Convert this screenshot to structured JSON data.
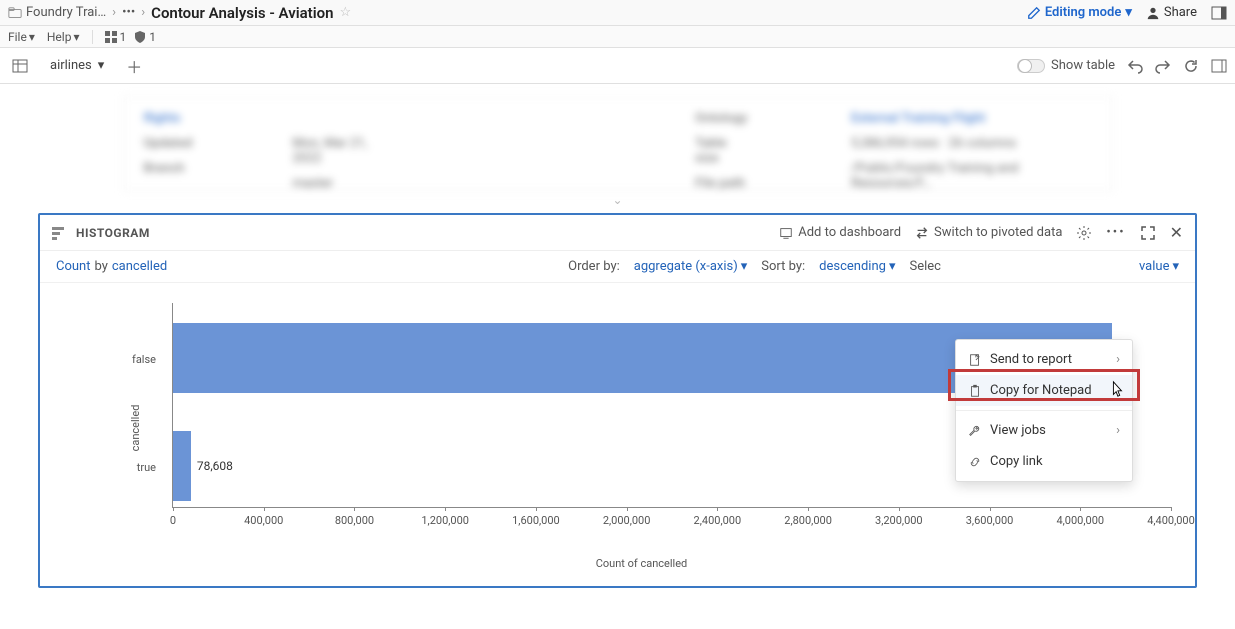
{
  "breadcrumb": {
    "item1": "Foundry Trai…",
    "ellipsis": "•••",
    "title": "Contour Analysis - Aviation"
  },
  "header": {
    "editing_mode": "Editing mode",
    "share": "Share"
  },
  "menubar": {
    "file": "File",
    "help": "Help",
    "badge1_count": "1",
    "badge2_count": "1"
  },
  "toolbar": {
    "dataset_chip": "airlines",
    "show_table": "Show table"
  },
  "blurred": {
    "col1": {
      "a": "flights",
      "b": "Updated",
      "c": "Branch"
    },
    "col2": {
      "a": "",
      "b": "Mon, Mar 21, 2022",
      "c": "master"
    },
    "col3": {
      "a": "Ontology",
      "b": "Table size",
      "c": "File path"
    },
    "col4": {
      "a": "External Training Flight",
      "b": "5,386,954 rows · 26 columns",
      "c": "/Public/Foundry Training and Resources/F…"
    }
  },
  "panel": {
    "title": "HISTOGRAM",
    "add_dashboard": "Add to dashboard",
    "switch_pivoted": "Switch to pivoted data",
    "count": "Count",
    "by": "by",
    "cancelled": "cancelled",
    "order_by_lbl": "Order by:",
    "order_by_val": "aggregate (x-axis)",
    "sort_by_lbl": "Sort by:",
    "sort_by_val": "descending",
    "select_lbl": "Select",
    "select_partial": "Selec",
    "value": "value"
  },
  "chart_data": {
    "type": "bar",
    "orientation": "horizontal",
    "categories": [
      "false",
      "true"
    ],
    "values": [
      4140000,
      78608
    ],
    "value_labels": [
      "",
      "78,608"
    ],
    "xlabel": "Count of cancelled",
    "ylabel": "cancelled",
    "xlim": [
      0,
      4400000
    ],
    "ticks": [
      0,
      400000,
      800000,
      1200000,
      1600000,
      2000000,
      2400000,
      2800000,
      3200000,
      3600000,
      4000000,
      4400000
    ],
    "tick_labels": [
      "0",
      "400,000",
      "800,000",
      "1,200,000",
      "1,600,000",
      "2,000,000",
      "2,400,000",
      "2,800,000",
      "3,200,000",
      "3,600,000",
      "4,000,000",
      "4,400,000"
    ]
  },
  "context_menu": {
    "send_report": "Send to report",
    "copy_notepad": "Copy for Notepad",
    "view_jobs": "View jobs",
    "copy_link": "Copy link"
  }
}
